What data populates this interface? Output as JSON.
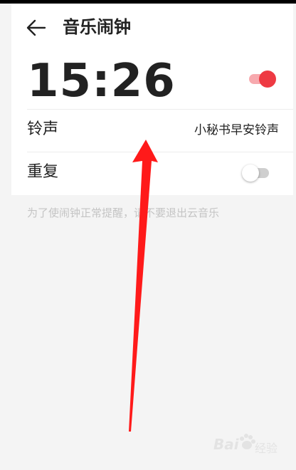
{
  "header": {
    "title": "音乐闹钟",
    "back_icon": "arrow-left-icon"
  },
  "alarm": {
    "time": "15:26",
    "enabled": true,
    "accent": "#ee3a43"
  },
  "ringtone": {
    "label": "铃声",
    "value": "小秘书早安铃声"
  },
  "repeat": {
    "label": "重复",
    "enabled": false
  },
  "hint": "为了使闹钟正常提醒，请不要退出云音乐",
  "annotation": {
    "arrow_color": "#ff1a1a"
  },
  "watermark": {
    "logo_text": "Bai",
    "text": "经验"
  }
}
